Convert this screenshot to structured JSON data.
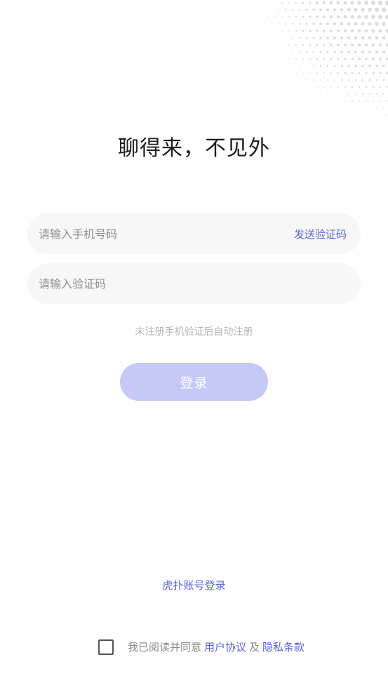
{
  "headline": "聊得来，不见外",
  "phone_field": {
    "placeholder": "请输入手机号码",
    "send_code_label": "发送验证码"
  },
  "code_field": {
    "placeholder": "请输入验证码"
  },
  "hint": "未注册手机验证后自动注册",
  "login_button": "登录",
  "alt_login": "虎扑账号登录",
  "agreement": {
    "prefix": "我已阅读并同意",
    "user_agreement": "用户协议",
    "conjunction": "及",
    "privacy_policy": "隐私条款"
  },
  "colors": {
    "accent": "#5b64d6",
    "login_button_bg": "#c6c8f6",
    "field_bg": "#f7f7f8"
  }
}
